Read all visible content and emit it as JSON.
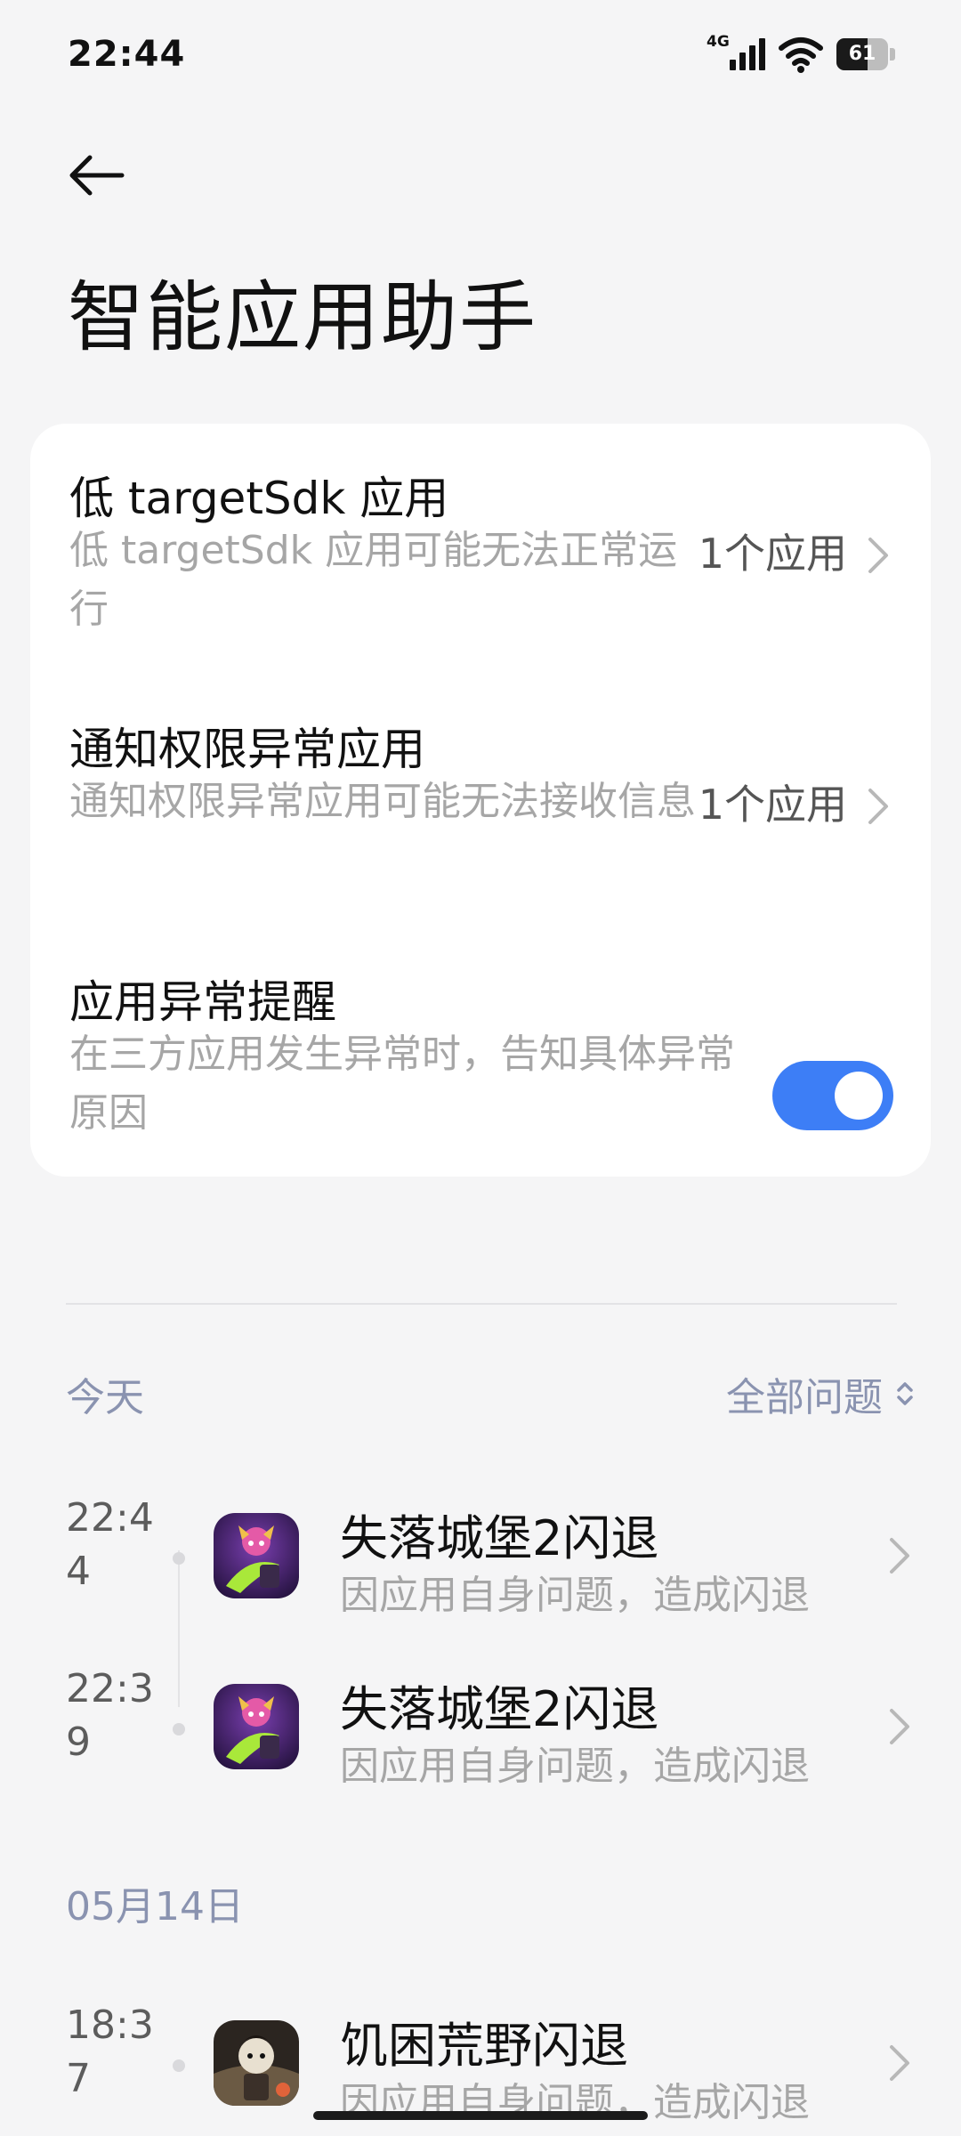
{
  "status_bar": {
    "time": "22:44",
    "network_type": "4G",
    "battery_level": "61",
    "battery_percent": 61,
    "icons": [
      "signal-icon",
      "wifi-icon",
      "battery-icon"
    ]
  },
  "header": {
    "back_icon": "back-arrow-icon",
    "title": "智能应用助手"
  },
  "settings": {
    "items": [
      {
        "title": "低 targetSdk 应用",
        "description": "低 targetSdk 应用可能无法正常运行",
        "value": "1个应用",
        "control": "chevron-right-icon"
      },
      {
        "title": "通知权限异常应用",
        "description": "通知权限异常应用可能无法接收信息",
        "value": "1个应用",
        "control": "chevron-right-icon"
      },
      {
        "title": "应用异常提醒",
        "description": "在三方应用发生异常时，告知具体异常原因",
        "toggle_on": true,
        "control": "toggle-switch"
      }
    ]
  },
  "logs": {
    "filter_label": "全部问题",
    "filter_icon": "sort-updown-icon",
    "sections": [
      {
        "label": "今天",
        "entries": [
          {
            "time": "22:44",
            "app": "失落城堡2闪退",
            "reason": "因应用自身问题，造成闪退",
            "icon": "lost-castle-2-app-icon"
          },
          {
            "time": "22:39",
            "app": "失落城堡2闪退",
            "reason": "因应用自身问题，造成闪退",
            "icon": "lost-castle-2-app-icon"
          }
        ]
      },
      {
        "label": "05月14日",
        "entries": [
          {
            "time": "18:37",
            "app": "饥困荒野闪退",
            "reason": "因应用自身问题，造成闪退",
            "icon": "dont-starve-app-icon"
          }
        ]
      }
    ]
  },
  "colors": {
    "accent": "#3d7ef6",
    "background": "#f5f5f6",
    "card": "#ffffff",
    "secondary_text": "#a6a6a6",
    "section_label": "#8a93b0"
  }
}
